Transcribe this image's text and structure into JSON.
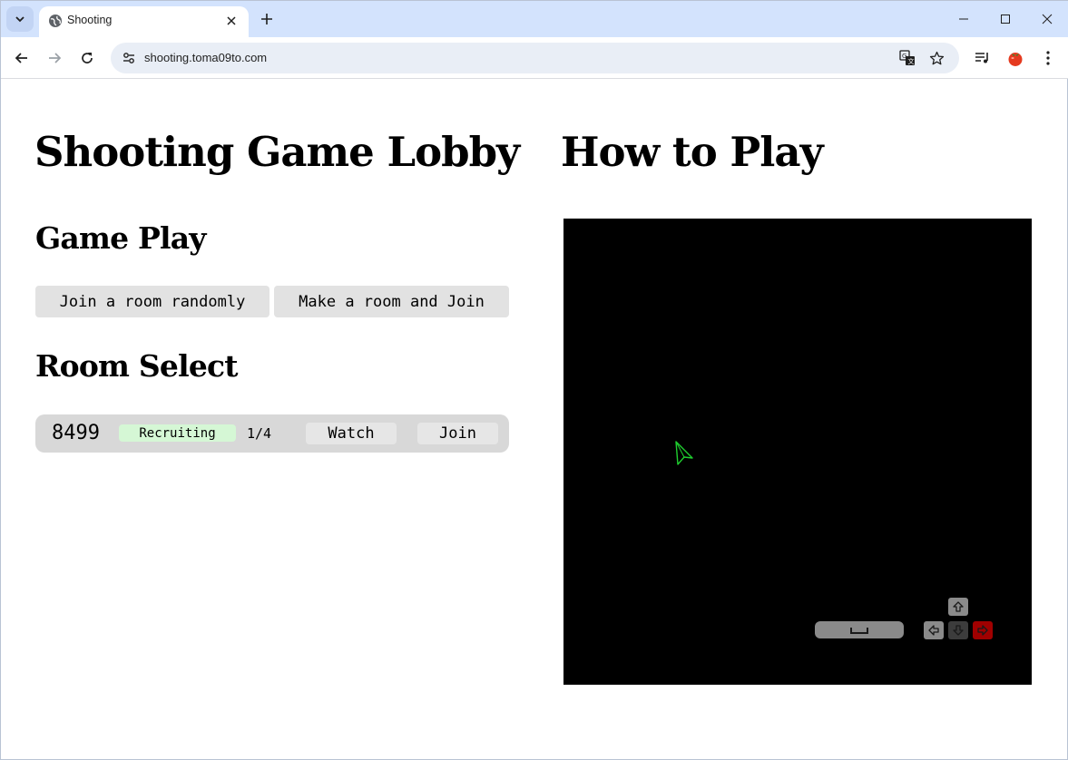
{
  "browser": {
    "tab_title": "Shooting",
    "url": "shooting.toma09to.com"
  },
  "lobby": {
    "title": "Shooting Game Lobby",
    "game_play_heading": "Game Play",
    "join_random_label": "Join a room randomly",
    "make_room_label": "Make a room and Join",
    "room_select_heading": "Room Select",
    "rooms": [
      {
        "id": "8499",
        "status": "Recruiting",
        "players": "1/4",
        "watch_label": "Watch",
        "join_label": "Join"
      }
    ]
  },
  "how_to_play": {
    "title": "How to Play"
  },
  "colors": {
    "tab_strip": "#d3e3fd",
    "omnibox": "#e9eef6",
    "button": "#e2e2e2",
    "room_row": "#d8d8d8",
    "status_badge": "#d5f7d5",
    "canvas": "#000000",
    "ship": "#1fcf2f",
    "key_right_active": "#a00000"
  },
  "icons": {
    "tab_search": "chevron-down-icon",
    "favicon": "globe-icon",
    "tab_close": "close-icon",
    "new_tab": "plus-icon",
    "back": "arrow-left-icon",
    "forward": "arrow-right-icon",
    "reload": "reload-icon",
    "site_info": "tune-icon",
    "translate": "translate-icon",
    "bookmark": "star-icon",
    "media": "media-queue-icon",
    "extension": "tomato-icon",
    "menu": "kebab-menu-icon",
    "ship": "ship-icon",
    "space_key": "space-key-icon",
    "arrow_keys": [
      "arrow-up-key-icon",
      "arrow-left-key-icon",
      "arrow-down-key-icon",
      "arrow-right-key-icon"
    ]
  }
}
